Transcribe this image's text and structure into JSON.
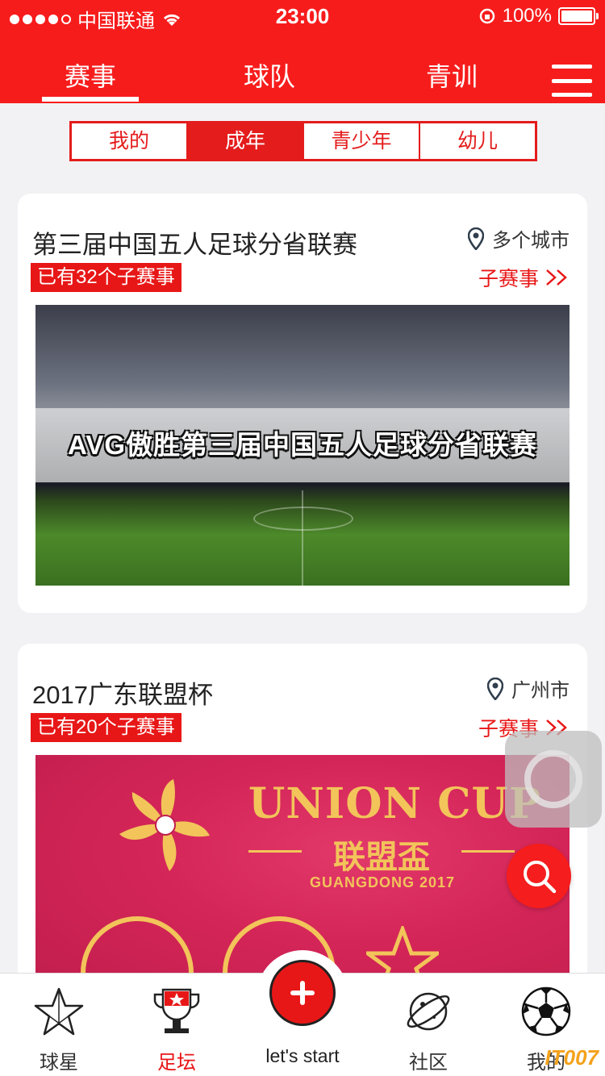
{
  "status_bar": {
    "carrier": "中国联通",
    "time": "23:00",
    "battery": "100%",
    "signal_bars": 4
  },
  "header": {
    "tabs": [
      {
        "label": "赛事",
        "active": true
      },
      {
        "label": "球队",
        "active": false
      },
      {
        "label": "青训",
        "active": false
      }
    ],
    "menu_icon": "hamburger-icon"
  },
  "filter": {
    "options": [
      {
        "label": "我的",
        "active": false
      },
      {
        "label": "成年",
        "active": true
      },
      {
        "label": "青少年",
        "active": false
      },
      {
        "label": "幼儿",
        "active": false
      }
    ]
  },
  "events": [
    {
      "title": "第三届中国五人足球分省联赛",
      "location": "多个城市",
      "sub_count_badge": "已有32个子赛事",
      "more_label": "子赛事",
      "more_icon": "double-chevron-right-icon",
      "banner_text": "AVG傲胜第三届中国五人足球分省联赛"
    },
    {
      "title": "2017广东联盟杯",
      "location": "广州市",
      "sub_count_badge": "已有20个子赛事",
      "more_label": "子赛事",
      "more_icon": "double-chevron-right-icon",
      "banner_title": "UNION CUP",
      "banner_sub": "联盟盃",
      "banner_year": "GUANGDONG 2017"
    }
  ],
  "bottom_nav": {
    "items": [
      {
        "label": "球星",
        "icon": "star-icon"
      },
      {
        "label": "足坛",
        "icon": "trophy-icon",
        "active": true
      },
      {
        "label": "let's start",
        "icon": "plus-icon"
      },
      {
        "label": "社区",
        "icon": "planet-icon"
      },
      {
        "label": "我的",
        "icon": "soccer-ball-icon"
      }
    ]
  },
  "watermark": "IT007",
  "colors": {
    "brand_red": "#f71c1c",
    "accent_red": "#e81717",
    "gold": "#f2c45a"
  }
}
